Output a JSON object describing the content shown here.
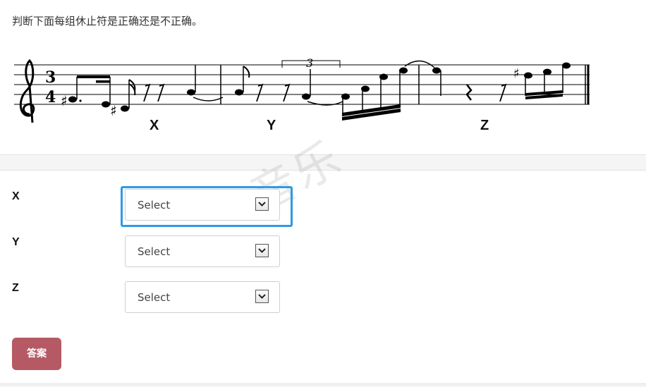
{
  "question": "判断下面每组休止符是正确还是不正确。",
  "score_marks": [
    "X",
    "Y",
    "Z"
  ],
  "triplet_number": "3",
  "time_signature": {
    "top": "3",
    "bottom": "4"
  },
  "watermark": "音乐",
  "rows": [
    {
      "label": "X",
      "select_value": "Select"
    },
    {
      "label": "Y",
      "select_value": "Select"
    },
    {
      "label": "Z",
      "select_value": "Select"
    }
  ],
  "answer_button": "答案",
  "accent": {
    "focus": "#2e9ae6",
    "button": "#b55a64"
  }
}
